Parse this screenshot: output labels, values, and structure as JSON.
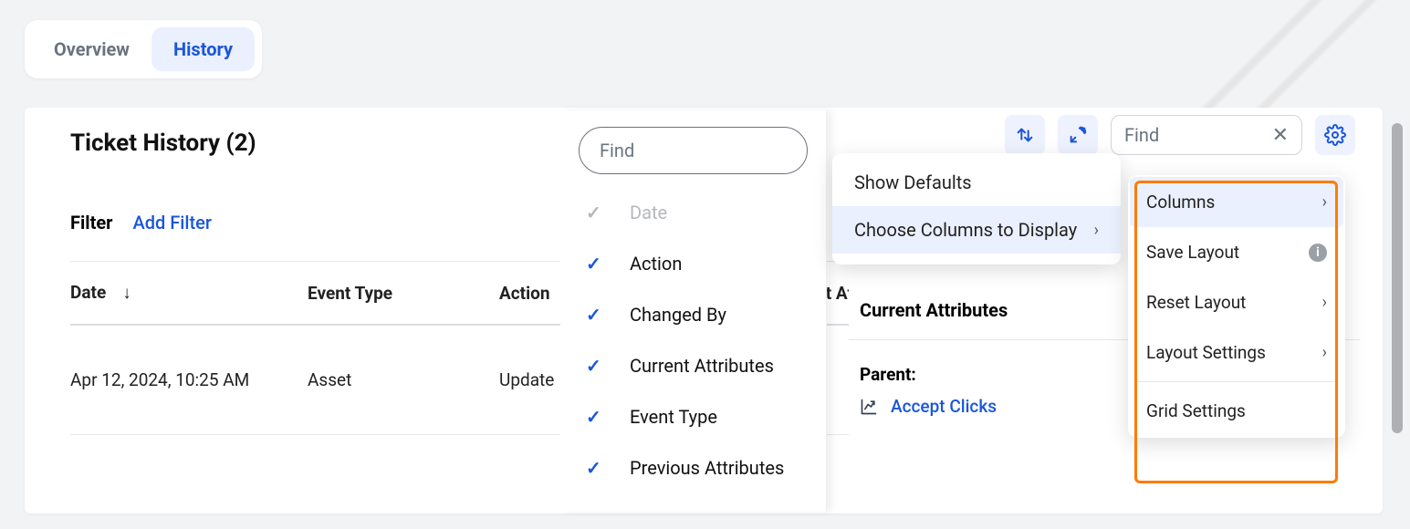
{
  "tabs": {
    "overview": "Overview",
    "history": "History"
  },
  "page": {
    "title": "Ticket History (2)"
  },
  "filter": {
    "label": "Filter",
    "add": "Add Filter"
  },
  "columns": {
    "date": "Date",
    "event_type": "Event Type",
    "action": "Action",
    "current_attributes": "Current Attributes"
  },
  "rows": [
    {
      "date": "Apr 12, 2024, 10:25 AM",
      "event_type": "Asset",
      "action": "Update"
    }
  ],
  "toolbar": {
    "find_placeholder": "Find"
  },
  "col_chooser": {
    "find_placeholder": "Find",
    "items": [
      {
        "label": "Date",
        "checked": true,
        "disabled": true
      },
      {
        "label": "Action",
        "checked": true,
        "disabled": false
      },
      {
        "label": "Changed By",
        "checked": true,
        "disabled": false
      },
      {
        "label": "Current Attributes",
        "checked": true,
        "disabled": false
      },
      {
        "label": "Event Type",
        "checked": true,
        "disabled": false
      },
      {
        "label": "Previous Attributes",
        "checked": true,
        "disabled": false
      }
    ]
  },
  "submenu": {
    "show_defaults": "Show Defaults",
    "choose_columns": "Choose Columns to Display"
  },
  "right": {
    "section": "Current Attributes",
    "parent_label": "Parent:",
    "parent_link": "Accept Clicks"
  },
  "settings": {
    "columns": "Columns",
    "save_layout": "Save Layout",
    "reset_layout": "Reset Layout",
    "layout_settings": "Layout Settings",
    "grid_settings": "Grid Settings"
  }
}
